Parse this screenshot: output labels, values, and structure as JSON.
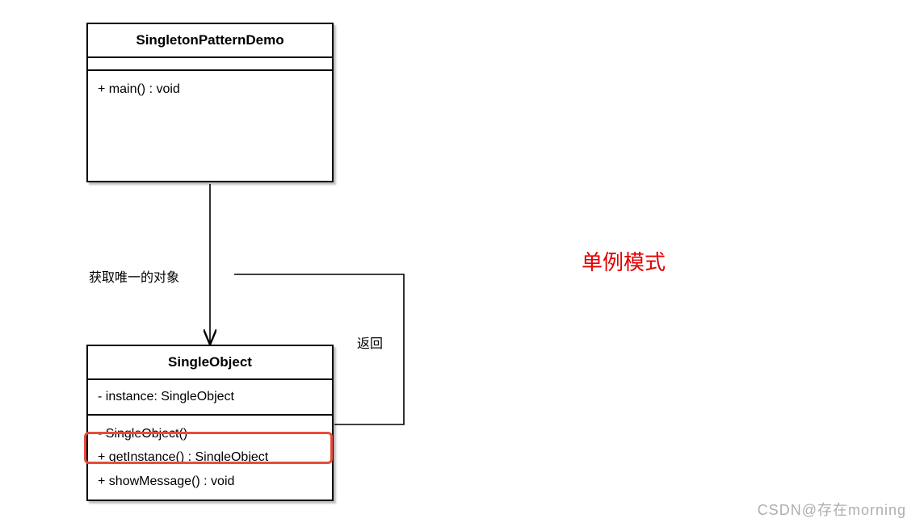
{
  "diagram": {
    "annotation": "单例模式",
    "watermark": "CSDN@存在morning",
    "edges": {
      "demoToObject": {
        "label": "获取唯一的对象"
      },
      "objectSelf": {
        "label": "返回"
      }
    },
    "classes": {
      "demo": {
        "name": "SingletonPatternDemo",
        "attributes": [],
        "methods": [
          "+ main() : void"
        ]
      },
      "single": {
        "name": "SingleObject",
        "attributes": [
          "- instance: SingleObject"
        ],
        "methods": [
          "- SingleObject()",
          "+ getInstance() : SingleObject",
          "+ showMessage() : void"
        ],
        "highlightedMethodIndex": 1
      }
    }
  }
}
